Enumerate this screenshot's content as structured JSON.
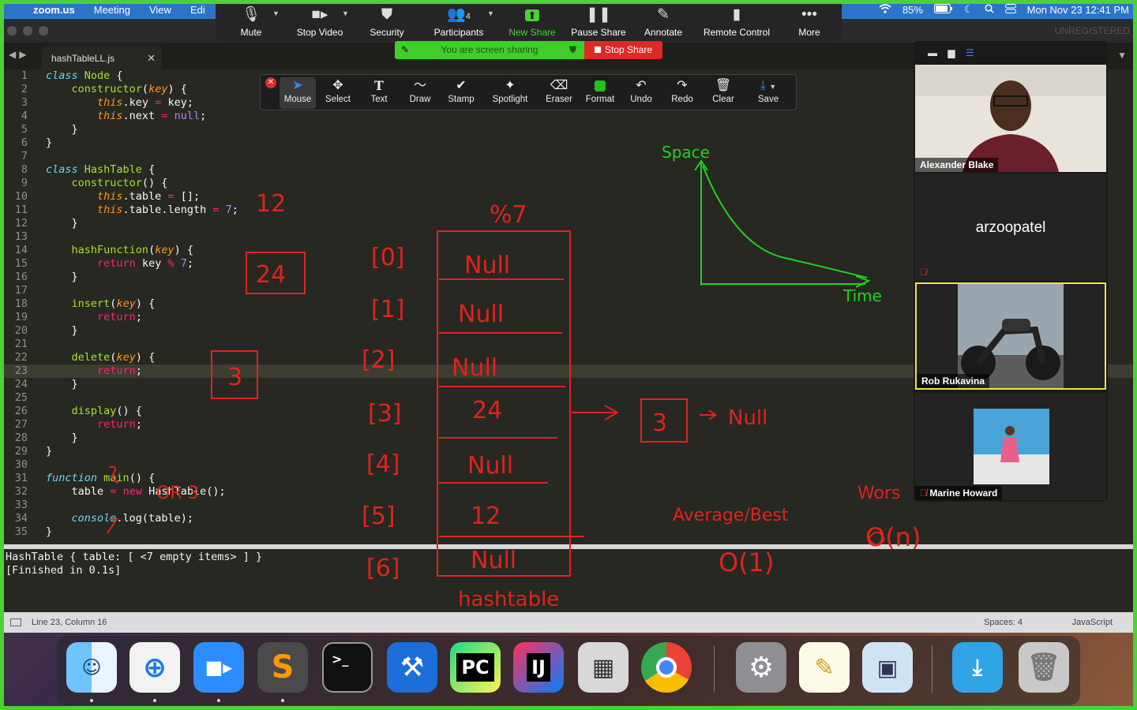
{
  "menubar": {
    "app": "zoom.us",
    "items": [
      "Meeting",
      "View",
      "Edi"
    ],
    "battery": "85%",
    "datetime": "Mon Nov 23  12:41 PM"
  },
  "zoom_toolbar": {
    "items": [
      {
        "label": "Mute",
        "icon": "microphone-icon"
      },
      {
        "label": "Stop Video",
        "icon": "video-camera-icon"
      },
      {
        "label": "Security",
        "icon": "shield-icon"
      },
      {
        "label": "Participants",
        "icon": "participants-icon",
        "count": "4"
      },
      {
        "label": "New Share",
        "icon": "share-arrow-icon"
      },
      {
        "label": "Pause Share",
        "icon": "pause-icon"
      },
      {
        "label": "Annotate",
        "icon": "pencil-icon"
      },
      {
        "label": "Remote Control",
        "icon": "mouse-icon"
      },
      {
        "label": "More",
        "icon": "ellipsis-icon"
      }
    ]
  },
  "share_banner": {
    "status": "You are screen sharing",
    "stop_label": "Stop Share"
  },
  "annotate_bar": {
    "tools": [
      "Mouse",
      "Select",
      "Text",
      "Draw",
      "Stamp",
      "Spotlight",
      "Eraser",
      "Format",
      "Undo",
      "Redo",
      "Clear",
      "Save"
    ],
    "format_color": "#20c020"
  },
  "editor": {
    "unregistered": "UNREGISTERED",
    "tab": "hashTableLL.js",
    "current_line": 23,
    "output": [
      "HashTable { table: [ <7 empty items> ] }",
      "[Finished in 0.1s]"
    ],
    "status": {
      "position": "Line 23, Column 16",
      "spaces": "Spaces: 4",
      "language": "JavaScript"
    }
  },
  "participants": [
    {
      "name": "Alexander Blake",
      "type": "video"
    },
    {
      "name": "arzoopatel",
      "type": "name-only"
    },
    {
      "name": "Rob Rukavina",
      "type": "image",
      "active": true
    },
    {
      "name": "Marine Howard",
      "type": "image",
      "muted": true
    }
  ],
  "annotations": {
    "mod": "%7",
    "indices": [
      "[0]",
      "[1]",
      "[2]",
      "[3]",
      "[4]",
      "[5]",
      "[6]"
    ],
    "cells": [
      "Null",
      "Null",
      "Null",
      "24",
      "Null",
      "12",
      "Null"
    ],
    "caption": "hashtable",
    "chain_node": "3",
    "chain_null": "Null",
    "left_numbers": [
      "12",
      "24",
      "3"
    ],
    "code_note": "OR 3",
    "space_label": "Space",
    "time_label": "Time",
    "avg_label": "Average/Best",
    "avg_value": "O(1)",
    "worst_label": "Wors",
    "worst_value": "O(n)",
    "ink_red": "#e0231e",
    "ink_green": "#1ed41e"
  },
  "dock": [
    "Finder",
    "Safari",
    "Zoom",
    "Sublime Text",
    "Terminal",
    "Xcode",
    "PyCharm",
    "IntelliJ IDEA",
    "Calculator",
    "Chrome",
    "System Preferences",
    "TextEdit",
    "Preview",
    "Downloads",
    "Trash"
  ]
}
